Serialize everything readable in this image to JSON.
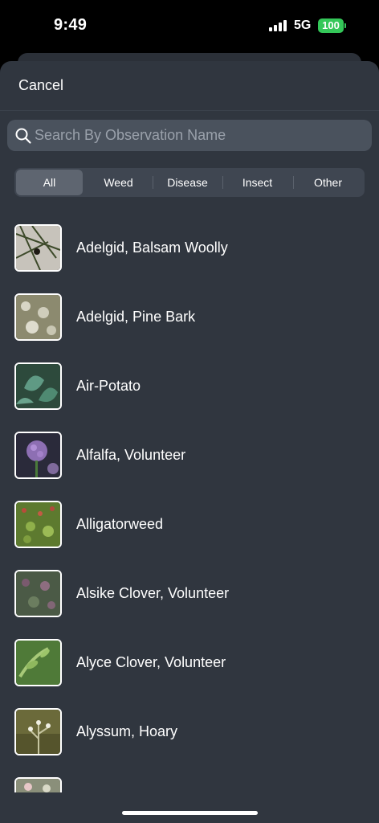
{
  "status_bar": {
    "time": "9:49",
    "network": "5G",
    "battery": "100"
  },
  "header": {
    "cancel_label": "Cancel"
  },
  "search": {
    "placeholder": "Search By Observation Name",
    "value": ""
  },
  "filters": {
    "selected": "All",
    "options": [
      {
        "label": "All"
      },
      {
        "label": "Weed"
      },
      {
        "label": "Disease"
      },
      {
        "label": "Insect"
      },
      {
        "label": "Other"
      }
    ]
  },
  "observations": [
    {
      "name": "Adelgid, Balsam Woolly",
      "thumbnail": "balsam-woolly-adelgid-photo"
    },
    {
      "name": "Adelgid, Pine Bark",
      "thumbnail": "pine-bark-adelgid-photo"
    },
    {
      "name": "Air-Potato",
      "thumbnail": "air-potato-photo"
    },
    {
      "name": "Alfalfa, Volunteer",
      "thumbnail": "alfalfa-photo"
    },
    {
      "name": "Alligatorweed",
      "thumbnail": "alligatorweed-photo"
    },
    {
      "name": "Alsike Clover, Volunteer",
      "thumbnail": "alsike-clover-photo"
    },
    {
      "name": "Alyce Clover, Volunteer",
      "thumbnail": "alyce-clover-photo"
    },
    {
      "name": "Alyssum, Hoary",
      "thumbnail": "hoary-alyssum-photo"
    }
  ],
  "colors": {
    "sheet_bg": "#30363f",
    "search_bg": "#4a525d",
    "segment_selected": "#5e6570",
    "battery": "#34c759"
  }
}
